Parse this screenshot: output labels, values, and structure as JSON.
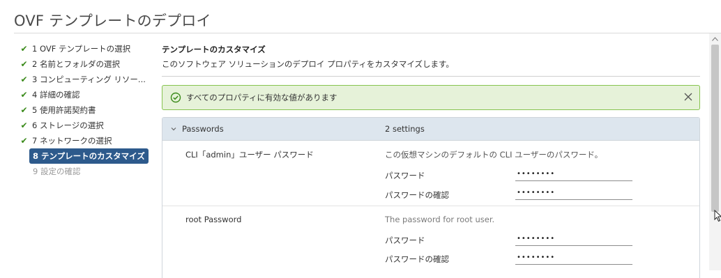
{
  "window": {
    "title": "OVF テンプレートのデプロイ"
  },
  "steps": [
    {
      "label": "1 OVF テンプレートの選択",
      "state": "done"
    },
    {
      "label": "2 名前とフォルダの選択",
      "state": "done"
    },
    {
      "label": "3 コンピューティング リソー...",
      "state": "done"
    },
    {
      "label": "4 詳細の確認",
      "state": "done"
    },
    {
      "label": "5 使用許諾契約書",
      "state": "done"
    },
    {
      "label": "6 ストレージの選択",
      "state": "done"
    },
    {
      "label": "7 ネットワークの選択",
      "state": "done"
    },
    {
      "label": "8 テンプレートのカスタマイズ",
      "state": "active"
    },
    {
      "label": "9 設定の確認",
      "state": "pending"
    }
  ],
  "section": {
    "title": "テンプレートのカスタマイズ",
    "description": "このソフトウェア ソリューションのデプロイ プロパティをカスタマイズします。"
  },
  "alert": {
    "text": "すべてのプロパティに有効な値があります",
    "status_color": "#86c34f",
    "icon": "check-circle-icon"
  },
  "group": {
    "name": "Passwords",
    "count": "2 settings",
    "expanded": true
  },
  "properties": [
    {
      "name": "CLI「admin」ユーザー パスワード",
      "description": "この仮想マシンのデフォルトの CLI ユーザーのパスワード。",
      "password_label": "パスワード",
      "password_value": "••••••••",
      "confirm_label": "パスワードの確認",
      "confirm_value": "••••••••"
    },
    {
      "name": "root Password",
      "description": "The password for root user.",
      "password_label": "パスワード",
      "password_value": "••••••••",
      "confirm_label": "パスワードの確認",
      "confirm_value": "••••••••"
    }
  ],
  "colors": {
    "accent": "#2d5a8c",
    "success": "#3a8a1a",
    "group_header_bg": "#dde6ee"
  }
}
